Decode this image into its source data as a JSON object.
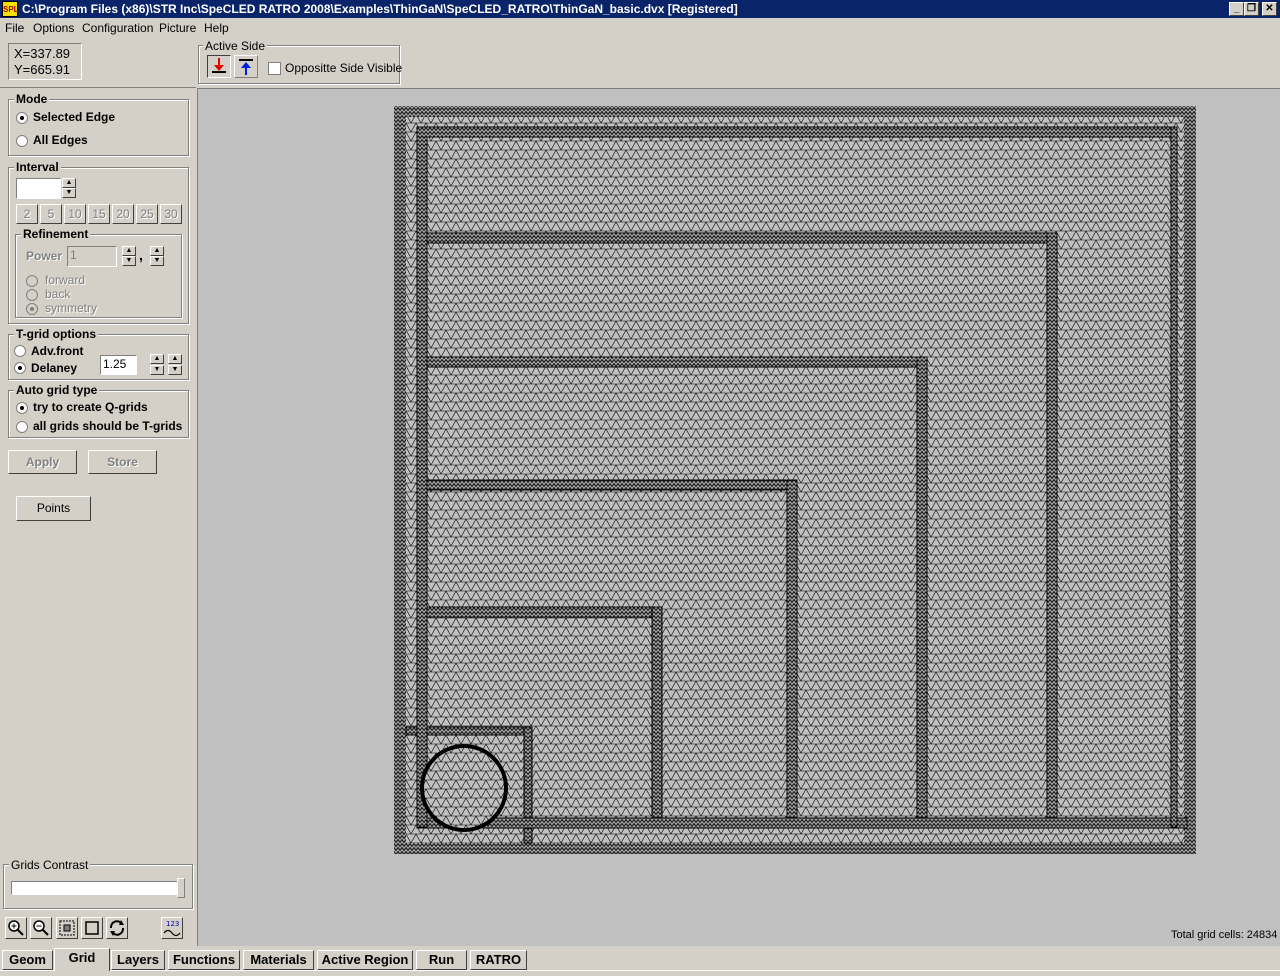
{
  "window": {
    "title": "C:\\Program Files (x86)\\STR Inc\\SpeCLED RATRO 2008\\Examples\\ThinGaN\\SpeCLED_RATRO\\ThinGaN_basic.dvx  [Registered]",
    "icon_label": "SPL",
    "minimize": "_",
    "restore": "❐",
    "close": "✕"
  },
  "menu": [
    "File",
    "Options",
    "Configuration",
    "Picture",
    "Help"
  ],
  "coords": {
    "x": "X=337.89",
    "y": "Y=665.91"
  },
  "active_side": {
    "label": "Active Side",
    "opposite_visible_label": "Oppositte Side Visible",
    "opposite_visible_checked": false
  },
  "mode": {
    "label": "Mode",
    "options": [
      "Selected Edge",
      "All Edges"
    ],
    "selected": "Selected Edge"
  },
  "interval": {
    "label": "Interval",
    "value": "",
    "presets": [
      "2",
      "5",
      "10",
      "15",
      "20",
      "25",
      "30"
    ],
    "refinement": {
      "label": "Refinement",
      "power_label": "Power",
      "power_value": "1",
      "comma": ",",
      "options": [
        "forward",
        "back",
        "symmetry"
      ],
      "selected": "symmetry"
    }
  },
  "tgrid": {
    "label": "T-grid options",
    "options": [
      "Adv.front",
      "Delaney"
    ],
    "selected": "Delaney",
    "value": "1.25"
  },
  "auto_grid": {
    "label": "Auto grid type",
    "options": [
      "try to create Q-grids",
      "all grids should be T-grids"
    ],
    "selected": "try to create Q-grids"
  },
  "buttons": {
    "apply": "Apply",
    "store": "Store",
    "points": "Points"
  },
  "grids_contrast": {
    "label": "Grids Contrast",
    "value": 1.0
  },
  "toolbar_icons": [
    "zoom-in-icon",
    "zoom-out-icon",
    "zoom-window-icon",
    "zoom-fit-icon",
    "refresh-icon",
    "numbering-icon"
  ],
  "status": {
    "total_cells": "Total grid cells: 24834"
  },
  "tabs": [
    "Geom",
    "Grid",
    "Layers",
    "Functions",
    "Materials",
    "Active Region",
    "Run",
    "RATRO"
  ],
  "active_tab": "Grid"
}
